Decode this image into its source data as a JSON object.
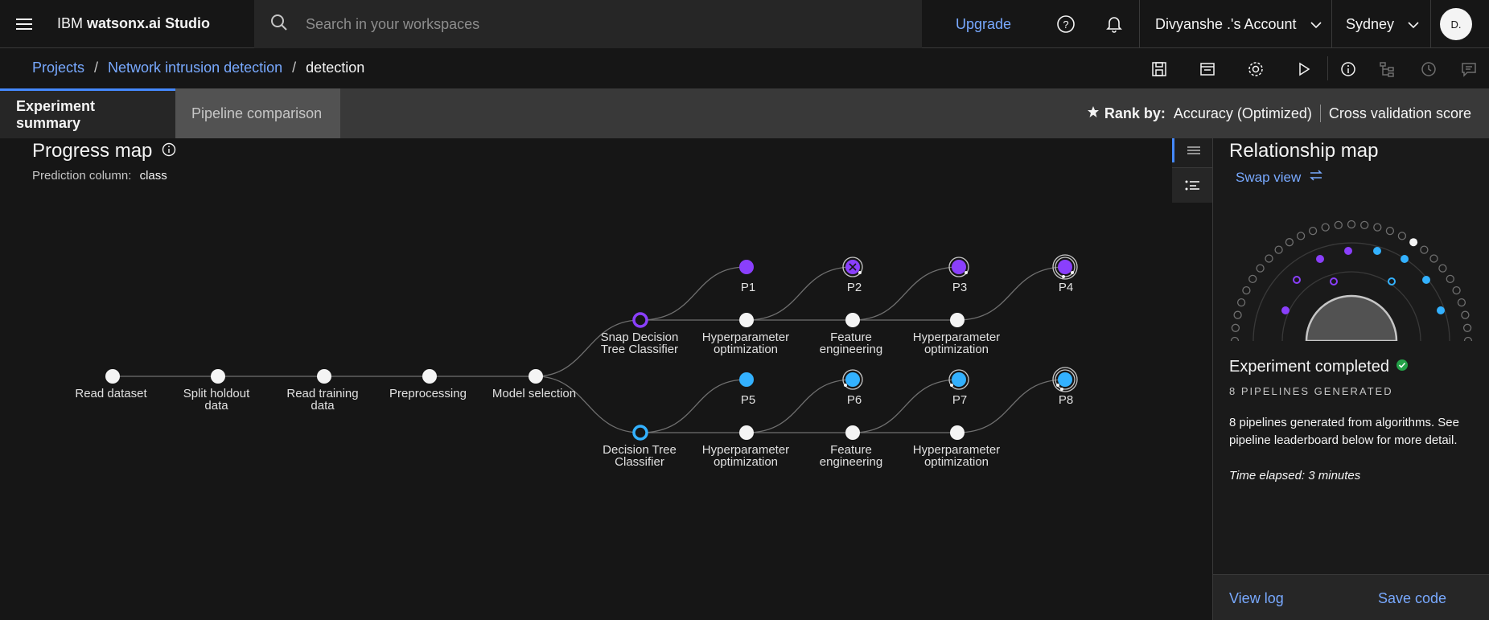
{
  "header": {
    "brand_prefix": "IBM",
    "brand_name": "watsonx.ai Studio",
    "search_placeholder": "Search in your workspaces",
    "upgrade": "Upgrade",
    "account": "Divyanshe .'s Account",
    "region": "Sydney",
    "avatar": "D."
  },
  "breadcrumb": {
    "projects": "Projects",
    "project": "Network intrusion detection",
    "current": "detection"
  },
  "tabs": {
    "summary": "Experiment summary",
    "comparison": "Pipeline comparison"
  },
  "rank": {
    "label": "Rank by:",
    "metric": "Accuracy (Optimized)",
    "score": "Cross validation score"
  },
  "progress_map": {
    "title": "Progress map",
    "prediction_label": "Prediction column:",
    "prediction_value": "class",
    "main_steps": [
      "Read dataset",
      "Split holdout data",
      "Read training data",
      "Preprocessing",
      "Model selection"
    ],
    "branches": [
      {
        "algorithm": "Snap Decision Tree Classifier",
        "steps": [
          "Hyperparameter optimization",
          "Feature engineering",
          "Hyperparameter optimization"
        ],
        "pipelines": [
          "P1",
          "P2",
          "P3",
          "P4"
        ]
      },
      {
        "algorithm": "Decision Tree Classifier",
        "steps": [
          "Hyperparameter optimization",
          "Feature engineering",
          "Hyperparameter optimization"
        ],
        "pipelines": [
          "P5",
          "P6",
          "P7",
          "P8"
        ]
      }
    ]
  },
  "relationship_map": {
    "title": "Relationship map",
    "swap_view": "Swap view",
    "status": "Experiment completed",
    "generated": "8 PIPELINES GENERATED",
    "description": "8 pipelines generated from algorithms. See pipeline leaderboard below for more detail.",
    "elapsed": "Time elapsed: 3 minutes",
    "view_log": "View log",
    "save_code": "Save code"
  },
  "colors": {
    "purple": "#8a3ffc",
    "blue": "#33b1ff",
    "link": "#78a9ff",
    "success": "#24a148"
  }
}
